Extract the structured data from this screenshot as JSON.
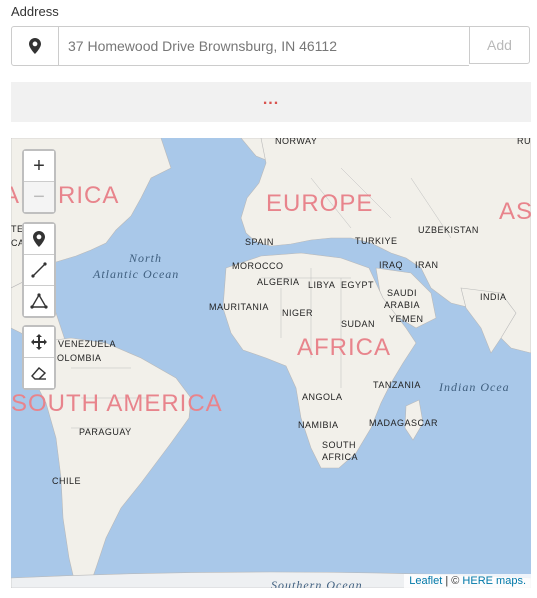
{
  "form": {
    "label": "Address",
    "address_value": "37 Homewood Drive Brownsburg, IN 46112",
    "add_label": "Add"
  },
  "status": {
    "indicator": "..."
  },
  "map": {
    "controls": {
      "zoom_in": "+",
      "zoom_out": "−"
    },
    "continents": [
      "AMERICA",
      "EUROPE",
      "ASIA",
      "AFRICA",
      "SOUTH AMERICA"
    ],
    "oceans": [
      "North",
      "Atlantic Ocean",
      "Indian Ocea",
      "Southern Ocean"
    ],
    "countries": [
      "NORWAY",
      "SPAIN",
      "TURKIYE",
      "UZBEKISTAN",
      "MOROCCO",
      "ALGERIA",
      "LIBYA",
      "EGYPT",
      "IRAQ",
      "IRAN",
      "SAUDI",
      "ARABIA",
      "INDIA",
      "MAURITANIA",
      "NIGER",
      "SUDAN",
      "YEMEN",
      "VENEZUELA",
      "COLOMBIA",
      "TANZANIA",
      "ANGOLA",
      "NAMIBIA",
      "MADAGASCAR",
      "SOUTH",
      "AFRICA",
      "PARAGUAY",
      "CHILE",
      "TED",
      "CA",
      "RU"
    ],
    "attribution": {
      "leaflet": "Leaflet",
      "sep": " | © ",
      "here": "HERE maps."
    },
    "colors": {
      "water": "#a9c8e9",
      "land": "#f2f0ea",
      "continent_label": "#e8848c"
    }
  }
}
